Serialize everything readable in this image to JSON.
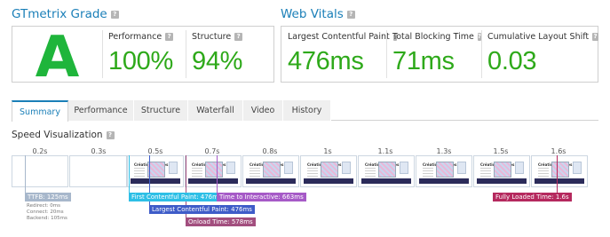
{
  "grade": {
    "title": "GTmetrix Grade",
    "letter": "A",
    "performance_label": "Performance",
    "performance_value": "100%",
    "structure_label": "Structure",
    "structure_value": "94%"
  },
  "vitals": {
    "title": "Web Vitals",
    "lcp_label": "Largest Contentful Paint",
    "lcp_value": "476ms",
    "tbt_label": "Total Blocking Time",
    "tbt_value": "71ms",
    "cls_label": "Cumulative Layout Shift",
    "cls_value": "0.03"
  },
  "help_glyph": "?",
  "tabs": [
    "Summary",
    "Performance",
    "Structure",
    "Waterfall",
    "Video",
    "History"
  ],
  "speed": {
    "title": "Speed Visualization",
    "times": [
      "0.2s",
      "0.3s",
      "0.5s",
      "0.7s",
      "0.8s",
      "1s",
      "1.1s",
      "1.3s",
      "1.5s",
      "1.6s"
    ],
    "thumb_title": "Création de sites",
    "ttfb": "TTFB: 125ms",
    "redirect": "Redirect: 0ms",
    "connect": "Connect: 20ms",
    "backend": "Backend: 105ms",
    "fcp": "First Contentful Paint: 476ms",
    "lcp": "Largest Contentful Paint: 476ms",
    "tti": "Time to Interactive: 663ms",
    "onload": "Onload Time: 578ms",
    "fully_loaded": "Fully Loaded Time: 1.6s"
  },
  "colors": {
    "brand": "#1a7fb8",
    "good": "#2ea91a",
    "grade_a": "#1fb53b",
    "ttfb": "#a7b7cb",
    "fcp": "#2ebfe6",
    "lcp": "#3e5cc8",
    "tti": "#a65ac7",
    "onload": "#a24e7e",
    "fully_loaded": "#b5295e"
  }
}
